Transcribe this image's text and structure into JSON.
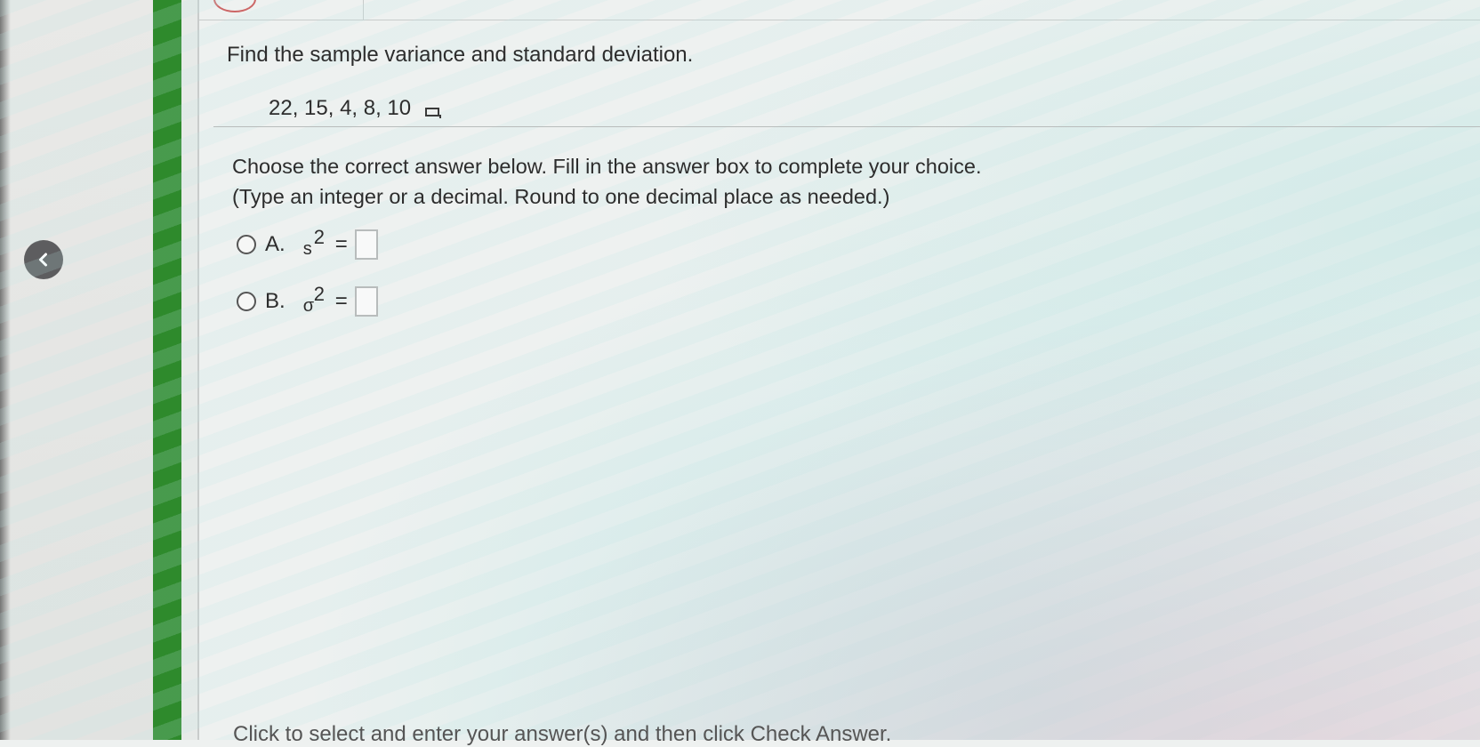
{
  "question": {
    "text": "Find the sample variance and standard deviation.",
    "data_values": "22, 15, 4, 8, 10"
  },
  "instructions": {
    "line1": "Choose the correct answer below. Fill in the answer box to complete your choice.",
    "line2": "(Type an integer or a decimal. Round to one decimal place as needed.)"
  },
  "choices": [
    {
      "letter": "A.",
      "symbol": "s",
      "exponent": "2",
      "equals": "=",
      "value": ""
    },
    {
      "letter": "B.",
      "symbol": "σ",
      "exponent": "2",
      "equals": "=",
      "value": ""
    }
  ],
  "footer": {
    "hint": "Click to select and enter your answer(s) and then click Check Answer."
  },
  "colors": {
    "accent_bar": "#2e8a2c",
    "back_button": "#5d5d5f"
  },
  "icons": {
    "back": "chevron-left-icon",
    "copy_data": "copy-data-icon"
  }
}
